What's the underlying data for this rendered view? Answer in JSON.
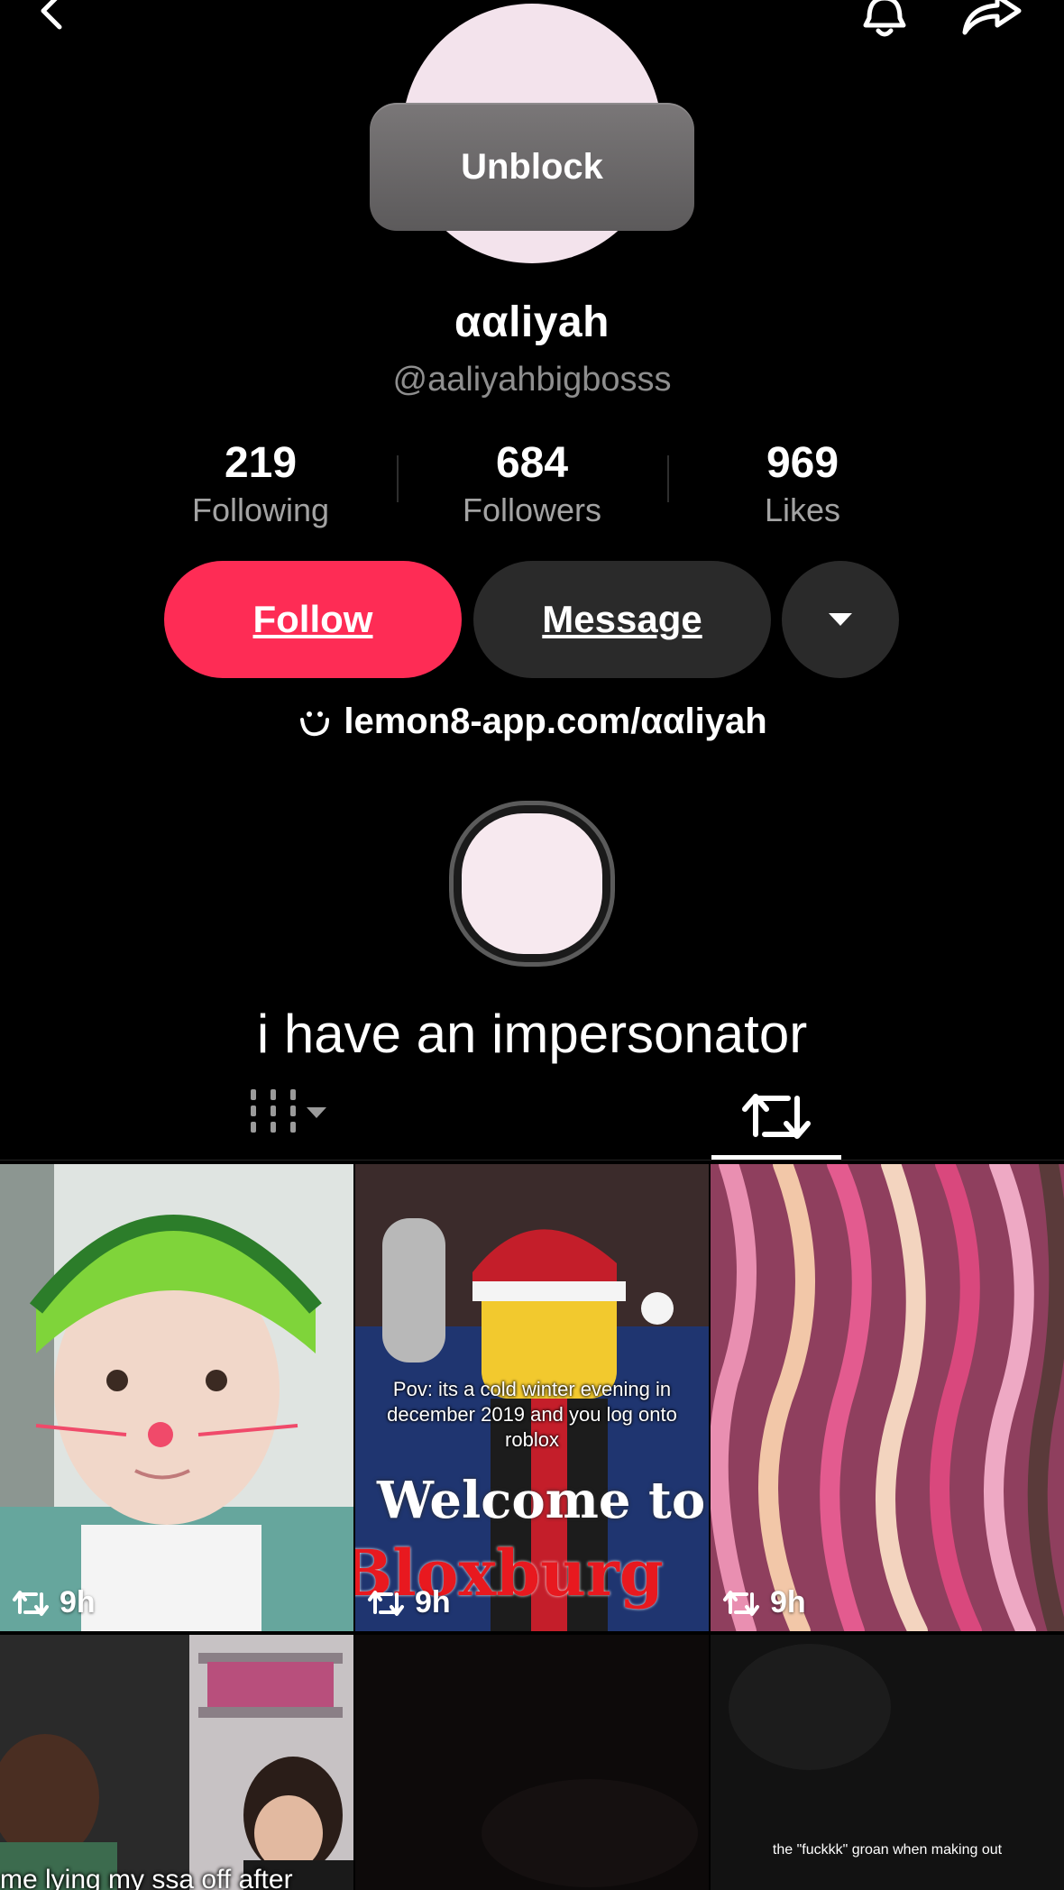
{
  "header": {
    "back_icon": "chevron-left-icon",
    "notification_icon": "bell-icon",
    "share_icon": "share-arrow-icon"
  },
  "profile": {
    "unblock_label": "Unblock",
    "display_name": "ααliyah",
    "username": "@aaliyahbigbosss",
    "link_icon": "smile-link-icon",
    "link": "lemon8-app.com/ααliyah",
    "bio": "i have an impersonator"
  },
  "stats": [
    {
      "value": "219",
      "label": "Following"
    },
    {
      "value": "684",
      "label": "Followers"
    },
    {
      "value": "969",
      "label": "Likes"
    }
  ],
  "actions": {
    "follow_label": "Follow",
    "message_label": "Message",
    "more_icon": "caret-down-icon"
  },
  "tabs": {
    "videos_icon": "video-grid-icon",
    "reposts_icon": "repost-icon",
    "active": "reposts"
  },
  "grid": [
    {
      "time": "9h",
      "repost_icon": "repost-icon"
    },
    {
      "time": "9h",
      "repost_icon": "repost-icon",
      "caption": "Pov: its a cold winter evening in december 2019 and you log onto roblox",
      "title_1": "Welcome to",
      "title_2": "Bloxburg"
    },
    {
      "time": "9h",
      "repost_icon": "repost-icon"
    },
    {
      "caption": "me lying my ssa off after"
    },
    {},
    {
      "caption": "the \"fuckkk\" groan when making out"
    }
  ],
  "colors": {
    "accent": "#fe2c55",
    "background": "#000000",
    "button_dark": "#2a2a2a",
    "secondary_text": "#a3a3a3"
  }
}
